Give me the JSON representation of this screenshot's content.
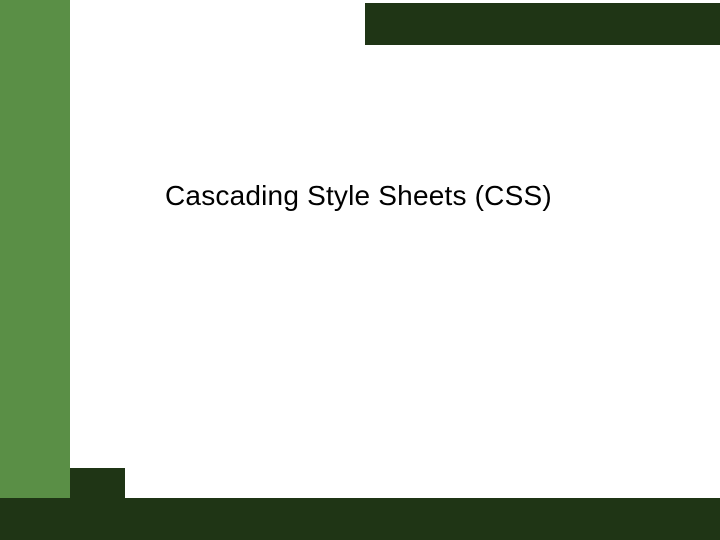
{
  "slide": {
    "title": "Cascading Style Sheets (CSS)"
  },
  "colors": {
    "sidebar": "#5a8f46",
    "bars": "#1f3515"
  }
}
